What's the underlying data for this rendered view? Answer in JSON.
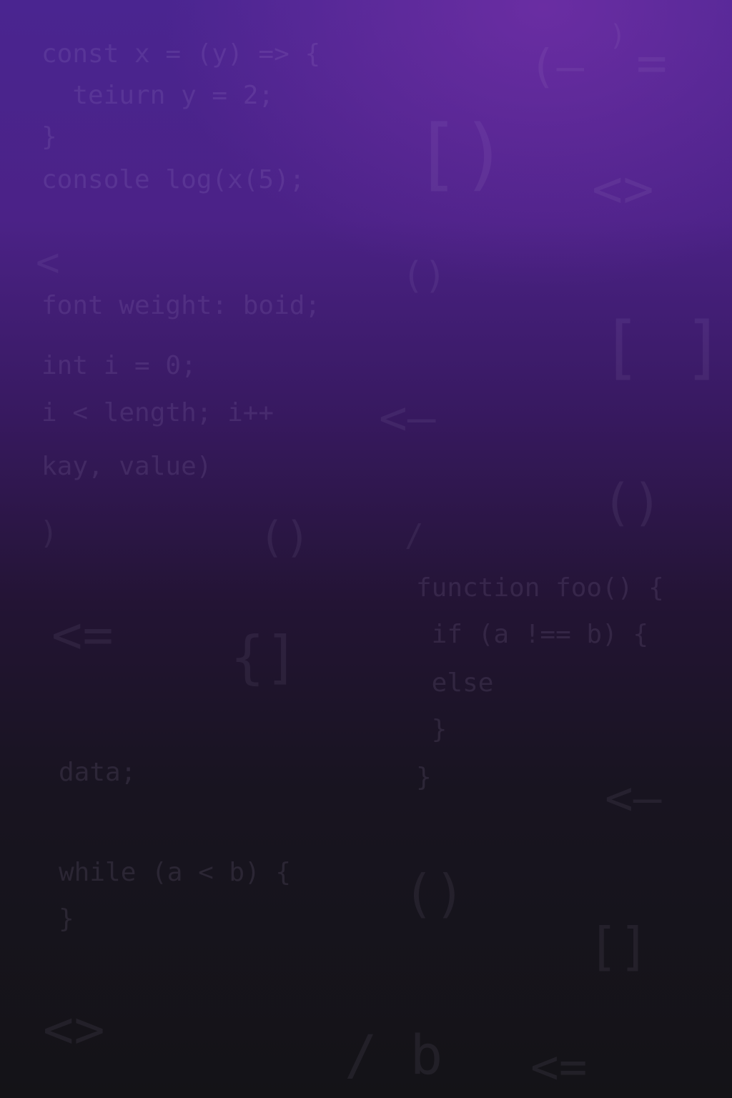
{
  "code_lines": {
    "l1": "const x = (y) => {",
    "l2": "  teiurn y = 2;",
    "l3": "}",
    "l4": "console log(x(5);",
    "l5": "font weight: boid;",
    "l6": "int i = 0;",
    "l7": "i < length; i++",
    "l8": "kay, value)",
    "l9": "function foo() {",
    "l10": " if (a !== b) {",
    "l11": " else",
    "l12": " }",
    "l13": "}",
    "l14": "data;",
    "l15": "while (a < b) {",
    "l16": "}"
  },
  "glyphs": {
    "g1": "(—",
    "g2": "[)",
    "g3": "<>",
    "g4": "<",
    "g5": "()",
    "g6": "[ ]",
    "g7": "<—",
    "g8": "()",
    "g9": ")",
    "g10": "()",
    "g11": "/",
    "g12": "<=",
    "g13": "{]",
    "g14": "<—",
    "g15": "()",
    "g16": "[]",
    "g17": "<>",
    "g18": "/ b",
    "g19": "<=",
    "g20": ")",
    "g21": "="
  }
}
